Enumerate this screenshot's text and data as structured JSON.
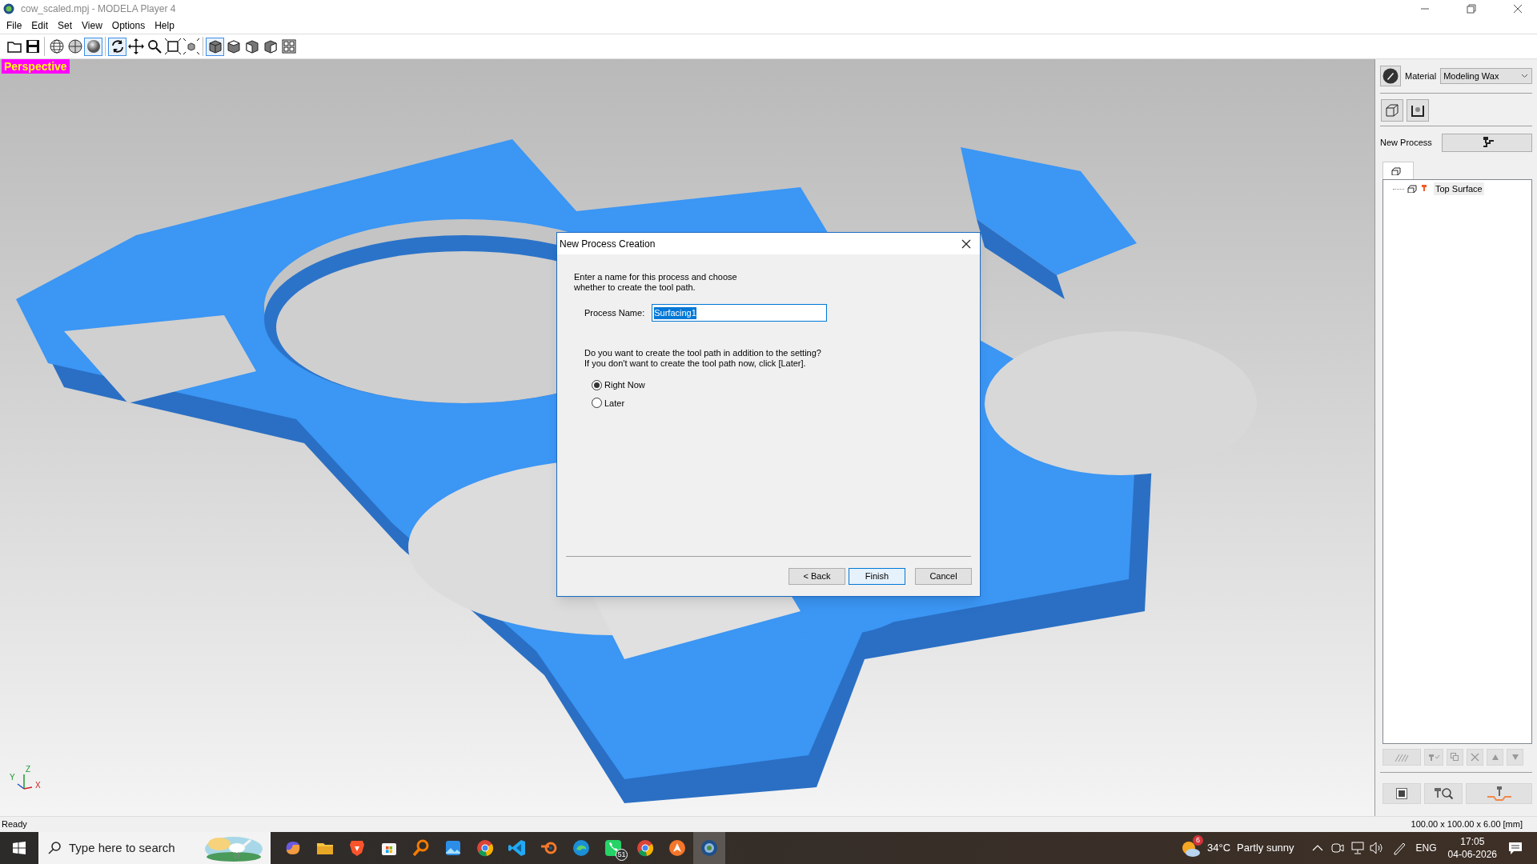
{
  "window": {
    "title": "cow_scaled.mpj - MODELA Player 4"
  },
  "menu": [
    "File",
    "Edit",
    "Set",
    "View",
    "Options",
    "Help"
  ],
  "toolbar": [
    [
      {
        "kind": "open",
        "selected": false
      },
      {
        "kind": "save",
        "selected": false
      }
    ],
    [
      {
        "kind": "wire",
        "selected": false
      },
      {
        "kind": "solid",
        "selected": false
      },
      {
        "kind": "shaded",
        "selected": true
      }
    ],
    [
      {
        "kind": "rotate",
        "selected": true
      },
      {
        "kind": "pan",
        "selected": false
      },
      {
        "kind": "zoom",
        "selected": false
      },
      {
        "kind": "fit",
        "selected": false
      },
      {
        "kind": "fit-model",
        "selected": false
      }
    ],
    [
      {
        "kind": "cube",
        "selected": true
      },
      {
        "kind": "cube-top",
        "selected": false
      },
      {
        "kind": "cube-front",
        "selected": false
      },
      {
        "kind": "cube-side",
        "selected": false
      },
      {
        "kind": "quad",
        "selected": false
      }
    ]
  ],
  "viewport": {
    "label": "Perspective",
    "axes": [
      "Z",
      "Y",
      "X"
    ]
  },
  "side_panel": {
    "material_label": "Material",
    "material": "Modeling Wax",
    "new_process_label": "New Process",
    "tree": [
      {
        "label": "Top Surface"
      }
    ]
  },
  "dialog": {
    "title": "New Process Creation",
    "intro": [
      "Enter a name for this process and choose",
      "whether to create the tool path."
    ],
    "name_label": "Process Name:",
    "name_value": "Surfacing1",
    "question": [
      "Do you want to create the tool path in addition to the setting?",
      "If you don't want to create the tool path now, click [Later]."
    ],
    "options": [
      {
        "label": "Right Now",
        "selected": true
      },
      {
        "label": "Later",
        "selected": false
      }
    ],
    "buttons": [
      {
        "label": "< Back",
        "kind": "normal"
      },
      {
        "label": "Finish",
        "kind": "default"
      },
      {
        "label": "Cancel",
        "kind": "normal"
      }
    ]
  },
  "status_bar": {
    "text": "Ready",
    "dimensions": "100.00 x 100.00 x 6.00 [mm]"
  },
  "taskbar": {
    "search_placeholder": "Type here to search",
    "apps": [
      {
        "kind": "copilot",
        "selected": false
      },
      {
        "kind": "folder",
        "selected": false
      },
      {
        "kind": "shield",
        "selected": false
      },
      {
        "kind": "store",
        "selected": false
      },
      {
        "kind": "magnifier",
        "selected": false
      },
      {
        "kind": "photos",
        "selected": false
      },
      {
        "kind": "chrome",
        "selected": false
      },
      {
        "kind": "code",
        "selected": false
      },
      {
        "kind": "blender",
        "selected": false
      },
      {
        "kind": "edge",
        "selected": false
      },
      {
        "kind": "chat",
        "selected": false,
        "badge": "51"
      },
      {
        "kind": "chrome",
        "selected": false
      },
      {
        "kind": "orange",
        "selected": false
      },
      {
        "kind": "modela",
        "selected": true
      }
    ],
    "weather_badge": "6",
    "temperature": "34°C",
    "weather": "Partly sunny",
    "language": "ENG",
    "time": "17:05",
    "date": "04-06-2026"
  }
}
